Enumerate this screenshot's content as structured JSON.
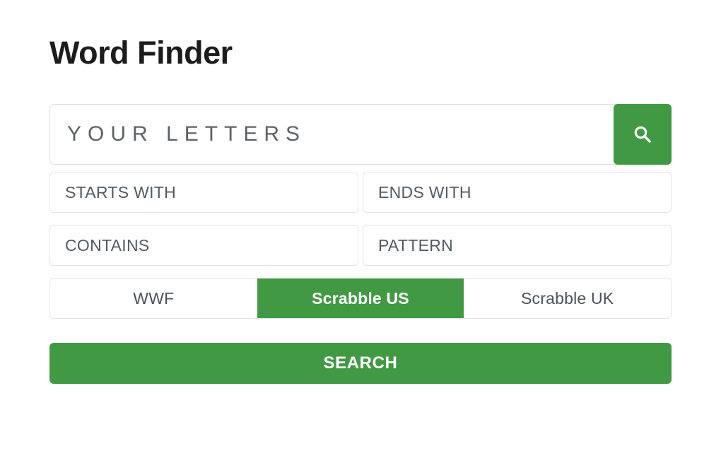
{
  "page": {
    "title": "Word Finder"
  },
  "letters_search": {
    "placeholder": "YOUR LETTERS",
    "value": "",
    "icon": "search-icon",
    "button_color": "#419a43"
  },
  "filters": [
    {
      "name": "starts-with",
      "placeholder": "STARTS WITH",
      "value": ""
    },
    {
      "name": "ends-with",
      "placeholder": "ENDS WITH",
      "value": ""
    },
    {
      "name": "contains",
      "placeholder": "CONTAINS",
      "value": ""
    },
    {
      "name": "pattern",
      "placeholder": "PATTERN",
      "value": ""
    }
  ],
  "dictionary": {
    "selected": "Scrabble US",
    "options": [
      {
        "label": "WWF",
        "active": false
      },
      {
        "label": "Scrabble US",
        "active": true
      },
      {
        "label": "Scrabble UK",
        "active": false
      }
    ],
    "active_color": "#419a43"
  },
  "submit": {
    "label": "SEARCH",
    "color": "#419a43"
  },
  "colors": {
    "accent_green": "#419a43",
    "text_dark": "#1c1c1c",
    "placeholder_text": "#515a63",
    "border": "#dddddd",
    "background": "#ffffff"
  }
}
